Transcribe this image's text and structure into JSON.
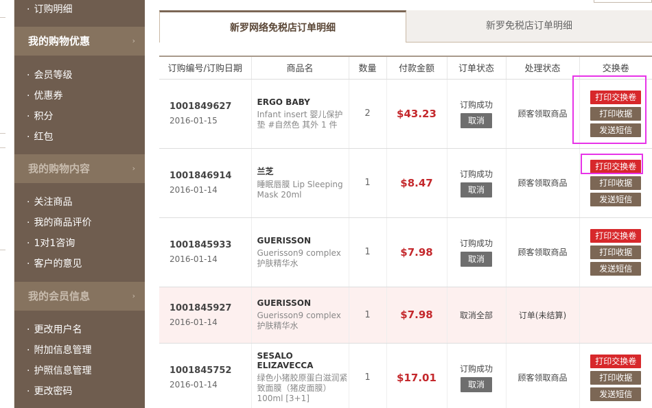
{
  "sidebar": {
    "top_item": "订购明细",
    "sections": [
      {
        "title": "我的购物优惠",
        "items": [
          "会员等级",
          "优惠券",
          "积分",
          "红包"
        ]
      },
      {
        "title": "我的购物内容",
        "items": [
          "关注商品",
          "我的商品评价",
          "1对1咨询",
          "客户的意见"
        ]
      },
      {
        "title": "我的会员信息",
        "items": [
          "更改用户名",
          "附加信息管理",
          "护照信息管理",
          "更改密码"
        ]
      }
    ],
    "chevron": "›"
  },
  "tabs": {
    "active": "新罗网络免税店订单明细",
    "inactive": "新罗免税店订单明细"
  },
  "table": {
    "headers": [
      "订购编号/订购日期",
      "商品名",
      "数量",
      "付款金额",
      "订单状态",
      "处理状态",
      "交换卷"
    ],
    "rows": [
      {
        "order_no": "1001849627",
        "date": "2016-01-15",
        "brand": "ERGO BABY",
        "desc": "Infant insert 婴儿保护垫 #自然色 其外 1 件",
        "qty": "2",
        "amount": "$43.23",
        "status": "订购成功",
        "cancel": "取消",
        "process": "顾客领取商品",
        "btn_print": "打印交换卷",
        "btn_receipt": "打印收据",
        "btn_sms": "发送短信"
      },
      {
        "order_no": "1001846914",
        "date": "2016-01-14",
        "brand": "兰芝",
        "desc": "睡眠唇膜 Lip Sleeping Mask 20ml",
        "qty": "1",
        "amount": "$8.47",
        "status": "订购成功",
        "cancel": "取消",
        "process": "顾客领取商品",
        "btn_print": "打印交换卷",
        "btn_receipt": "打印收据",
        "btn_sms": "发送短信"
      },
      {
        "order_no": "1001845933",
        "date": "2016-01-14",
        "brand": "GUERISSON",
        "desc": "Guerisson9 complex 护肤精华水",
        "qty": "1",
        "amount": "$7.98",
        "status": "订购成功",
        "cancel": "取消",
        "process": "顾客领取商品",
        "btn_print": "打印交换卷",
        "btn_receipt": "打印收据",
        "btn_sms": "发送短信"
      },
      {
        "order_no": "1001845927",
        "date": "2016-01-14",
        "brand": "GUERISSON",
        "desc": "Guerisson9 complex 护肤精华水",
        "qty": "1",
        "amount": "$7.98",
        "status": "取消全部",
        "process": "订单(未结算)"
      },
      {
        "order_no": "1001845752",
        "date": "2016-01-14",
        "brand": "SESALO ELIZAVECCA",
        "desc": "绿色小猪胶原蛋白滋润紧致面膜（猪皮面膜）100ml [3+1]",
        "qty": "1",
        "amount": "$17.01",
        "status": "订购成功",
        "cancel": "取消",
        "process": "顾客领取商品",
        "btn_print": "打印交换卷",
        "btn_receipt": "打印收据",
        "btn_sms": "发送短信"
      }
    ]
  },
  "colors": {
    "sidebar_bg": "#6f5d4f",
    "sidebar_head": "#86735f",
    "accent_red": "#d7282b",
    "button_brown": "#7c6755",
    "highlight": "#e733e8"
  }
}
